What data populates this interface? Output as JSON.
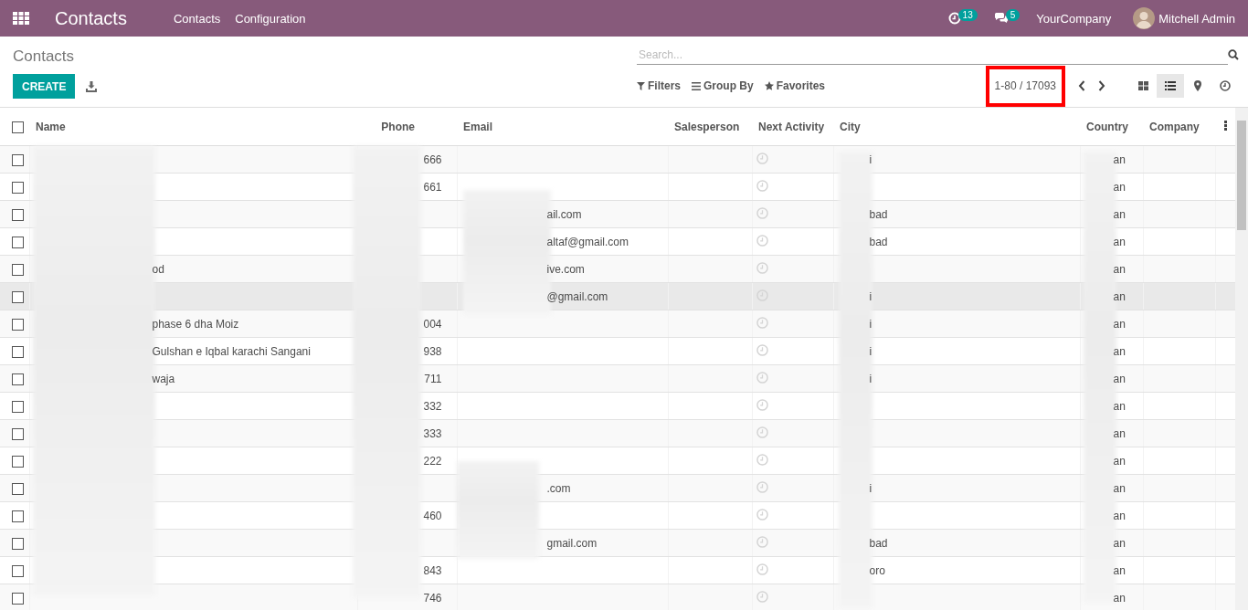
{
  "navbar": {
    "app_title": "Contacts",
    "menu": [
      "Contacts",
      "Configuration"
    ],
    "activity_count": "13",
    "message_count": "5",
    "company": "YourCompany",
    "user": "Mitchell Admin"
  },
  "control_panel": {
    "breadcrumb": "Contacts",
    "create_label": "CREATE",
    "search": {
      "placeholder": "Search..."
    },
    "filters": [
      "Filters",
      "Group By",
      "Favorites"
    ],
    "pager": "1-80 / 17093",
    "pager_highlighted": true,
    "views": [
      {
        "kind": "kanban",
        "selected": false
      },
      {
        "kind": "list",
        "selected": true
      },
      {
        "kind": "map",
        "selected": false
      },
      {
        "kind": "activity",
        "selected": false
      }
    ]
  },
  "table": {
    "all_checked": false,
    "columns": [
      "Name",
      "Phone",
      "Email",
      "Salesperson",
      "Next Activity",
      "City",
      "Country",
      "Company"
    ],
    "rows": [
      {
        "checked": false,
        "hovered": false,
        "name": "",
        "phone": "666",
        "email": "",
        "city": "i",
        "country": "an"
      },
      {
        "checked": false,
        "hovered": false,
        "name": "",
        "phone": "661",
        "email": "",
        "city": "",
        "country": "an"
      },
      {
        "checked": false,
        "hovered": false,
        "name": "",
        "phone": "",
        "email": "ail.com",
        "city": "bad",
        "country": "an"
      },
      {
        "checked": false,
        "hovered": false,
        "name": "",
        "phone": "",
        "email": "altaf@gmail.com",
        "city": "bad",
        "country": "an"
      },
      {
        "checked": false,
        "hovered": false,
        "name": "od",
        "phone": "",
        "email": "ive.com",
        "city": "",
        "country": "an"
      },
      {
        "checked": false,
        "hovered": true,
        "name": "",
        "phone": "",
        "email": "@gmail.com",
        "city": "i",
        "country": "an"
      },
      {
        "checked": false,
        "hovered": false,
        "name": "phase 6 dha Moiz",
        "phone": "004",
        "email": "",
        "city": "i",
        "country": "an"
      },
      {
        "checked": false,
        "hovered": false,
        "name": "Gulshan e Iqbal karachi Sangani",
        "phone": "938",
        "email": "",
        "city": "i",
        "country": "an"
      },
      {
        "checked": false,
        "hovered": false,
        "name": "waja",
        "phone": "711",
        "email": "",
        "city": "i",
        "country": "an"
      },
      {
        "checked": false,
        "hovered": false,
        "name": "",
        "phone": "332",
        "email": "",
        "city": "",
        "country": "an"
      },
      {
        "checked": false,
        "hovered": false,
        "name": "",
        "phone": "333",
        "email": "",
        "city": "",
        "country": "an"
      },
      {
        "checked": false,
        "hovered": false,
        "name": "",
        "phone": "222",
        "email": "",
        "city": "",
        "country": "an"
      },
      {
        "checked": false,
        "hovered": false,
        "name": "",
        "phone": "",
        "email": ".com",
        "city": "i",
        "country": "an"
      },
      {
        "checked": false,
        "hovered": false,
        "name": "",
        "phone": "460",
        "email": "",
        "city": "",
        "country": "an"
      },
      {
        "checked": false,
        "hovered": false,
        "name": "",
        "phone": "",
        "email": "gmail.com",
        "city": "bad",
        "country": "an"
      },
      {
        "checked": false,
        "hovered": false,
        "name": "",
        "phone": "843",
        "email": "",
        "city": "oro",
        "country": "an"
      },
      {
        "checked": false,
        "hovered": false,
        "name": "",
        "phone": "746",
        "email": "",
        "city": "",
        "country": "an"
      }
    ]
  }
}
